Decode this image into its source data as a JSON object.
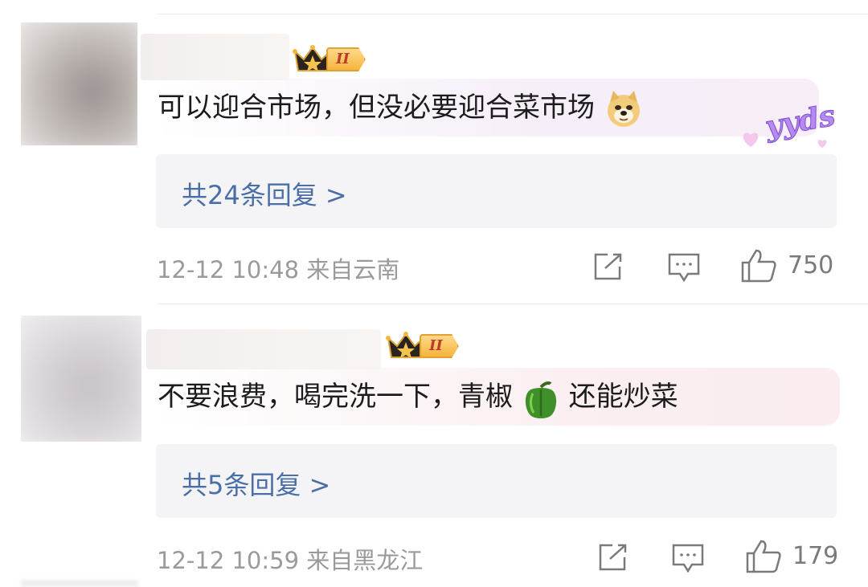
{
  "comments": [
    {
      "text_before_emoji": "可以迎合市场，但没必要迎合菜市场",
      "emoji_icon": "doge-face-icon",
      "sticker_text": "yyds",
      "level_badge": "II",
      "reply_link": "共24条回复 >",
      "time": "12-12 10:48",
      "location": "来自云南",
      "likes": "750"
    },
    {
      "text_before_emoji": "不要浪费，喝完洗一下，青椒",
      "emoji_icon": "green-pepper-icon",
      "text_after_emoji": "还能炒菜",
      "level_badge": "II",
      "reply_link": "共5条回复 >",
      "time": "12-12 10:59",
      "location": "来自黑龙江",
      "likes": "179"
    }
  ],
  "colors": {
    "link": "#4a6fa8",
    "meta": "#9a9a9a",
    "reply_bg": "#f4f4f6",
    "badge_gold": "#f5b53d"
  }
}
